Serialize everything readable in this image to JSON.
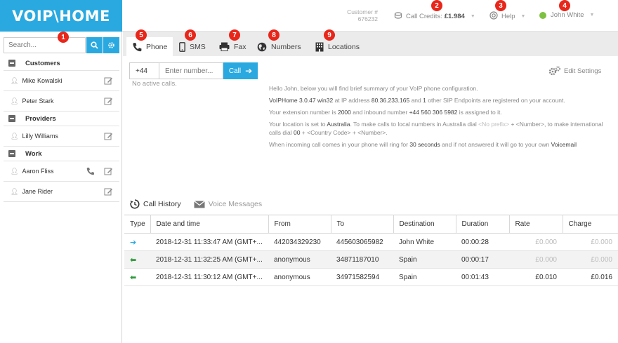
{
  "header": {
    "logo": "VOIP\\HOME",
    "customer_label": "Customer #",
    "customer_number": "676232",
    "credits_label": "Call Credits:",
    "credits_value": "£1.984",
    "help_label": "Help",
    "user_name": "John White"
  },
  "badges": [
    "1",
    "2",
    "3",
    "4",
    "5",
    "6",
    "7",
    "8",
    "9"
  ],
  "sidebar": {
    "search_placeholder": "Search...",
    "groups": [
      {
        "label": "Customers",
        "contacts": [
          {
            "name": "Mike Kowalski"
          },
          {
            "name": "Peter Stark"
          }
        ]
      },
      {
        "label": "Providers",
        "contacts": [
          {
            "name": "Lilly Williams"
          }
        ]
      },
      {
        "label": "Work",
        "contacts": [
          {
            "name": "Aaron Fliss"
          },
          {
            "name": "Jane Rider"
          }
        ]
      }
    ]
  },
  "tabs": [
    "Phone",
    "SMS",
    "Fax",
    "Numbers",
    "Locations"
  ],
  "dialer": {
    "country_code": "+44",
    "number_placeholder": "Enter number...",
    "call_label": "Call",
    "no_active": "No active calls.",
    "edit_settings": "Edit Settings"
  },
  "summary": {
    "greeting": "Hello John, below you will find brief summary of your VoIP phone configuration.",
    "version": "VoIPHome 3.0.47 win32",
    "ip": "80.36.233.165",
    "endpoints": "1",
    "extension": "2000",
    "inbound": "+44 560 306 5982",
    "location": "Australia",
    "no_prefix": "<No prefix>",
    "intl_prefix": "00",
    "ring_time": "30 seconds",
    "forward_to": "Voicemail"
  },
  "history": {
    "tab_call_history": "Call History",
    "tab_voice_messages": "Voice Messages",
    "columns": [
      "Type",
      "Date and time",
      "From",
      "To",
      "Destination",
      "Duration",
      "Rate",
      "Charge"
    ],
    "rows": [
      {
        "type": "in",
        "datetime": "2018-12-31 11:33:47 AM (GMT+...",
        "from": "442034329230",
        "to": "445603065982",
        "destination": "John White",
        "duration": "00:00:28",
        "rate": "£0.000",
        "charge": "£0.000"
      },
      {
        "type": "out",
        "datetime": "2018-12-31 11:32:25 AM (GMT+...",
        "from": "anonymous",
        "to": "34871187010",
        "destination": "Spain",
        "duration": "00:00:17",
        "rate": "£0.000",
        "charge": "£0.000"
      },
      {
        "type": "out",
        "datetime": "2018-12-31 11:30:12 AM (GMT+...",
        "from": "anonymous",
        "to": "34971582594",
        "destination": "Spain",
        "duration": "00:01:43",
        "rate": "£0.010",
        "charge": "£0.016"
      }
    ]
  }
}
